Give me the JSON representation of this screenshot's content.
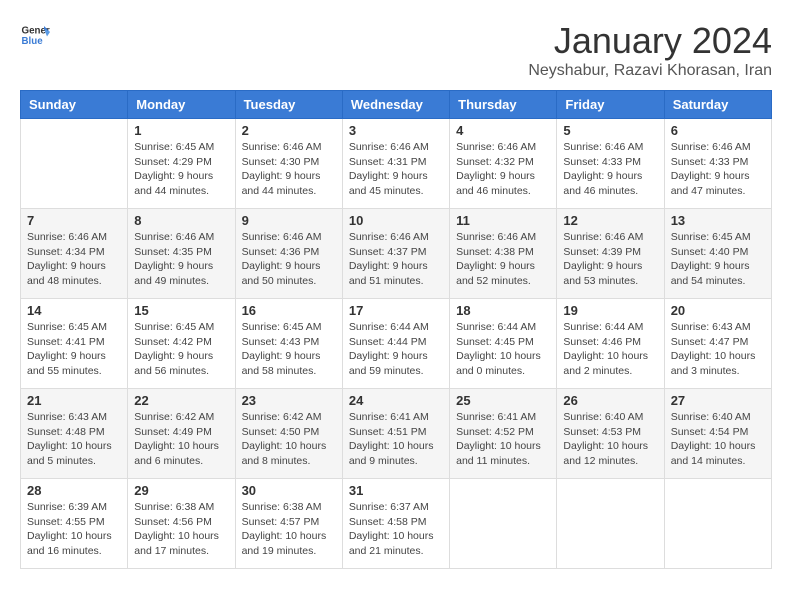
{
  "header": {
    "logo_general": "General",
    "logo_blue": "Blue",
    "month_title": "January 2024",
    "location": "Neyshabur, Razavi Khorasan, Iran"
  },
  "days_of_week": [
    "Sunday",
    "Monday",
    "Tuesday",
    "Wednesday",
    "Thursday",
    "Friday",
    "Saturday"
  ],
  "weeks": [
    {
      "alt": false,
      "days": [
        {
          "num": "",
          "info": ""
        },
        {
          "num": "1",
          "info": "Sunrise: 6:45 AM\nSunset: 4:29 PM\nDaylight: 9 hours\nand 44 minutes."
        },
        {
          "num": "2",
          "info": "Sunrise: 6:46 AM\nSunset: 4:30 PM\nDaylight: 9 hours\nand 44 minutes."
        },
        {
          "num": "3",
          "info": "Sunrise: 6:46 AM\nSunset: 4:31 PM\nDaylight: 9 hours\nand 45 minutes."
        },
        {
          "num": "4",
          "info": "Sunrise: 6:46 AM\nSunset: 4:32 PM\nDaylight: 9 hours\nand 46 minutes."
        },
        {
          "num": "5",
          "info": "Sunrise: 6:46 AM\nSunset: 4:33 PM\nDaylight: 9 hours\nand 46 minutes."
        },
        {
          "num": "6",
          "info": "Sunrise: 6:46 AM\nSunset: 4:33 PM\nDaylight: 9 hours\nand 47 minutes."
        }
      ]
    },
    {
      "alt": true,
      "days": [
        {
          "num": "7",
          "info": "Sunrise: 6:46 AM\nSunset: 4:34 PM\nDaylight: 9 hours\nand 48 minutes."
        },
        {
          "num": "8",
          "info": "Sunrise: 6:46 AM\nSunset: 4:35 PM\nDaylight: 9 hours\nand 49 minutes."
        },
        {
          "num": "9",
          "info": "Sunrise: 6:46 AM\nSunset: 4:36 PM\nDaylight: 9 hours\nand 50 minutes."
        },
        {
          "num": "10",
          "info": "Sunrise: 6:46 AM\nSunset: 4:37 PM\nDaylight: 9 hours\nand 51 minutes."
        },
        {
          "num": "11",
          "info": "Sunrise: 6:46 AM\nSunset: 4:38 PM\nDaylight: 9 hours\nand 52 minutes."
        },
        {
          "num": "12",
          "info": "Sunrise: 6:46 AM\nSunset: 4:39 PM\nDaylight: 9 hours\nand 53 minutes."
        },
        {
          "num": "13",
          "info": "Sunrise: 6:45 AM\nSunset: 4:40 PM\nDaylight: 9 hours\nand 54 minutes."
        }
      ]
    },
    {
      "alt": false,
      "days": [
        {
          "num": "14",
          "info": "Sunrise: 6:45 AM\nSunset: 4:41 PM\nDaylight: 9 hours\nand 55 minutes."
        },
        {
          "num": "15",
          "info": "Sunrise: 6:45 AM\nSunset: 4:42 PM\nDaylight: 9 hours\nand 56 minutes."
        },
        {
          "num": "16",
          "info": "Sunrise: 6:45 AM\nSunset: 4:43 PM\nDaylight: 9 hours\nand 58 minutes."
        },
        {
          "num": "17",
          "info": "Sunrise: 6:44 AM\nSunset: 4:44 PM\nDaylight: 9 hours\nand 59 minutes."
        },
        {
          "num": "18",
          "info": "Sunrise: 6:44 AM\nSunset: 4:45 PM\nDaylight: 10 hours\nand 0 minutes."
        },
        {
          "num": "19",
          "info": "Sunrise: 6:44 AM\nSunset: 4:46 PM\nDaylight: 10 hours\nand 2 minutes."
        },
        {
          "num": "20",
          "info": "Sunrise: 6:43 AM\nSunset: 4:47 PM\nDaylight: 10 hours\nand 3 minutes."
        }
      ]
    },
    {
      "alt": true,
      "days": [
        {
          "num": "21",
          "info": "Sunrise: 6:43 AM\nSunset: 4:48 PM\nDaylight: 10 hours\nand 5 minutes."
        },
        {
          "num": "22",
          "info": "Sunrise: 6:42 AM\nSunset: 4:49 PM\nDaylight: 10 hours\nand 6 minutes."
        },
        {
          "num": "23",
          "info": "Sunrise: 6:42 AM\nSunset: 4:50 PM\nDaylight: 10 hours\nand 8 minutes."
        },
        {
          "num": "24",
          "info": "Sunrise: 6:41 AM\nSunset: 4:51 PM\nDaylight: 10 hours\nand 9 minutes."
        },
        {
          "num": "25",
          "info": "Sunrise: 6:41 AM\nSunset: 4:52 PM\nDaylight: 10 hours\nand 11 minutes."
        },
        {
          "num": "26",
          "info": "Sunrise: 6:40 AM\nSunset: 4:53 PM\nDaylight: 10 hours\nand 12 minutes."
        },
        {
          "num": "27",
          "info": "Sunrise: 6:40 AM\nSunset: 4:54 PM\nDaylight: 10 hours\nand 14 minutes."
        }
      ]
    },
    {
      "alt": false,
      "days": [
        {
          "num": "28",
          "info": "Sunrise: 6:39 AM\nSunset: 4:55 PM\nDaylight: 10 hours\nand 16 minutes."
        },
        {
          "num": "29",
          "info": "Sunrise: 6:38 AM\nSunset: 4:56 PM\nDaylight: 10 hours\nand 17 minutes."
        },
        {
          "num": "30",
          "info": "Sunrise: 6:38 AM\nSunset: 4:57 PM\nDaylight: 10 hours\nand 19 minutes."
        },
        {
          "num": "31",
          "info": "Sunrise: 6:37 AM\nSunset: 4:58 PM\nDaylight: 10 hours\nand 21 minutes."
        },
        {
          "num": "",
          "info": ""
        },
        {
          "num": "",
          "info": ""
        },
        {
          "num": "",
          "info": ""
        }
      ]
    }
  ]
}
